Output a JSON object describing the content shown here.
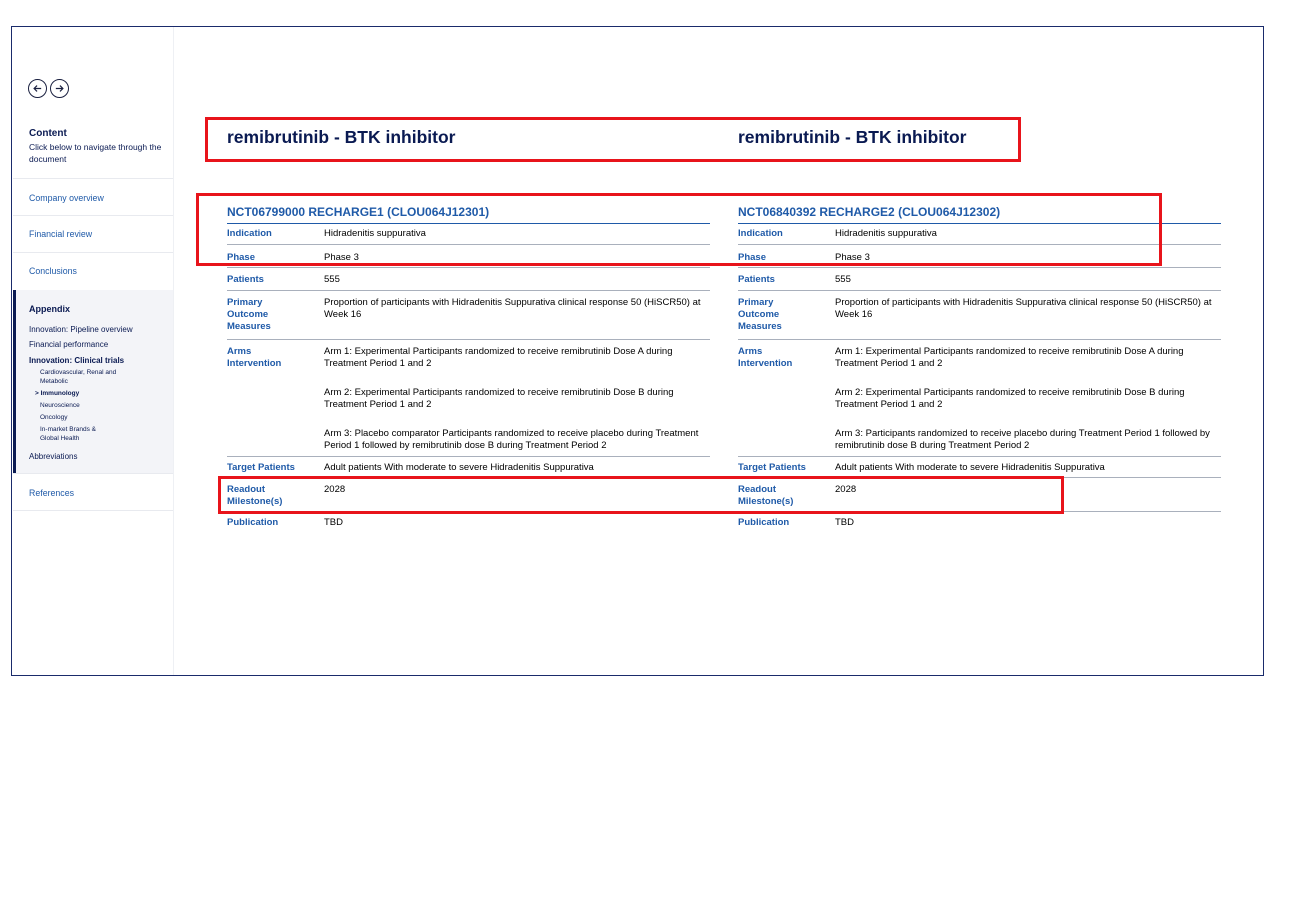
{
  "sidebar": {
    "content_title": "Content",
    "content_subtitle": "Click below to navigate through the document",
    "nav": [
      "Company overview",
      "Financial review",
      "Conclusions"
    ],
    "appendix_title": "Appendix",
    "appendix_items": [
      "Innovation: Pipeline overview",
      "Financial performance",
      "Innovation: Clinical trials"
    ],
    "clinical_sub": [
      "Cardiovascular, Renal and Metabolic",
      "> Immunology",
      "Neuroscience",
      "Oncology",
      "In-market Brands & Global Health"
    ],
    "abbreviations": "Abbreviations",
    "references": "References",
    "icons": [
      "arrow-left-icon",
      "arrow-right-icon"
    ]
  },
  "headings": [
    "remibrutinib - BTK inhibitor",
    "remibrutinib - BTK inhibitor"
  ],
  "trials": [
    {
      "title": "NCT06799000 RECHARGE1 (CLOU064J12301)",
      "indication_label": "Indication",
      "indication": "Hidradenitis suppurativa",
      "phase_label": "Phase",
      "phase": "Phase 3",
      "patients_label": "Patients",
      "patients": "555",
      "pom_label": "Primary Outcome Measures",
      "pom": "Proportion of participants with Hidradenitis Suppurativa clinical response 50 (HiSCR50) at Week 16",
      "arms_label": "Arms Intervention",
      "arms": [
        "Arm 1: Experimental Participants randomized to receive remibrutinib Dose A during Treatment Period 1 and 2",
        "Arm 2: Experimental Participants randomized to receive remibrutinib Dose B during Treatment Period 1 and 2",
        "Arm 3: Placebo comparator Participants randomized to receive placebo during Treatment Period 1 followed by remibrutinib dose B during Treatment Period 2"
      ],
      "target_label": "Target Patients",
      "target": "Adult patients With moderate to severe Hidradenitis Suppurativa",
      "readout_label": "Readout Milestone(s)",
      "readout": "2028",
      "publication_label": "Publication",
      "publication": "TBD"
    },
    {
      "title": "NCT06840392 RECHARGE2 (CLOU064J12302)",
      "indication_label": "Indication",
      "indication": "Hidradenitis suppurativa",
      "phase_label": "Phase",
      "phase": "Phase 3",
      "patients_label": "Patients",
      "patients": "555",
      "pom_label": "Primary Outcome Measures",
      "pom": "Proportion of participants with Hidradenitis Suppurativa clinical response 50 (HiSCR50) at Week 16",
      "arms_label": "Arms Intervention",
      "arms": [
        "Arm 1: Experimental Participants randomized to receive remibrutinib Dose A during Treatment Period 1 and 2",
        "Arm 2: Experimental Participants randomized to receive remibrutinib Dose B during Treatment Period 1 and 2",
        "Arm 3: Participants randomized to receive placebo during Treatment Period 1 followed by remibrutinib dose B during Treatment Period 2"
      ],
      "target_label": "Target Patients",
      "target": "Adult patients With moderate to severe Hidradenitis Suppurativa",
      "readout_label": "Readout Milestone(s)",
      "readout": "2028",
      "publication_label": "Publication",
      "publication": "TBD"
    }
  ],
  "colors": {
    "navy": "#0a1a52",
    "blue": "#1f5aa8",
    "highlight": "#e8141b"
  }
}
